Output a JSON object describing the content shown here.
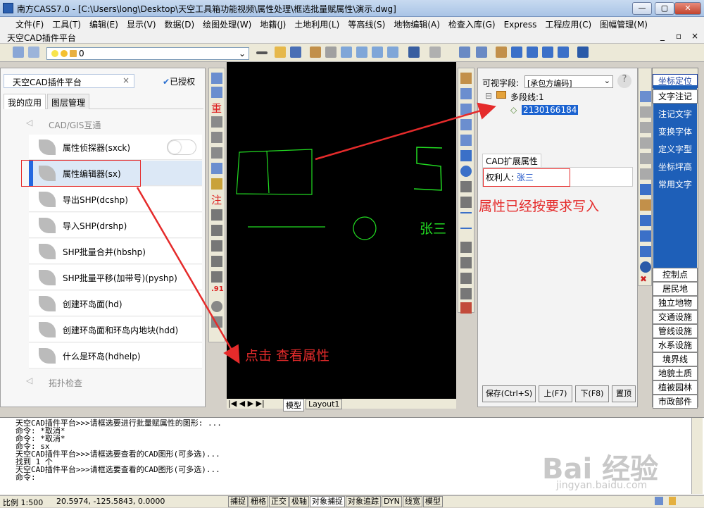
{
  "window": {
    "title": "南方CASS7.0 - [C:\\Users\\long\\Desktop\\天空工具箱功能视频\\属性处理\\框选批量赋属性\\演示.dwg]"
  },
  "menu": [
    "文件(F)",
    "工具(T)",
    "编辑(E)",
    "显示(V)",
    "数据(D)",
    "绘图处理(W)",
    "地籍(J)",
    "土地利用(L)",
    "等高线(S)",
    "地物编辑(A)",
    "检查入库(G)",
    "Express",
    "工程应用(C)",
    "图幅管理(M)"
  ],
  "subbar": {
    "label": "天空CAD插件平台"
  },
  "layer": {
    "value": "0"
  },
  "leftpanel": {
    "title": "天空CAD插件平台",
    "badge": "已授权",
    "tabs": [
      "我的应用",
      "图层管理"
    ],
    "section1": "CAD/GIS互通",
    "section2": "拓扑检查",
    "items": [
      "属性侦探器(sxck)",
      "属性编辑器(sx)",
      "导出SHP(dcshp)",
      "导入SHP(drshp)",
      "SHP批量合并(hbshp)",
      "SHP批量平移(加带号)(pyshp)",
      "创建环岛面(hd)",
      "创建环岛面和环岛内地块(hdd)",
      "什么是环岛(hdhelp)"
    ]
  },
  "left_strip_chars": [
    "重",
    "注",
    ".91"
  ],
  "cad": {
    "text": "张三",
    "tabs": [
      "模型",
      "Layout1"
    ]
  },
  "rightpanel": {
    "field_label": "可视字段:",
    "field_value": "[承包方编码]",
    "tree_root": "多段线:1",
    "tree_child": "2130166184",
    "attr_tab": "CAD扩展属性",
    "attr_key": "权利人:",
    "attr_value": "张三",
    "buttons": [
      "保存(Ctrl+S)",
      "上(F7)",
      "下(F8)",
      "置顶"
    ]
  },
  "farright": {
    "top": "坐标定位",
    "blue_items": [
      "文字注记",
      "注记文字",
      "变换字体",
      "定义字型",
      "坐标坪高",
      "常用文字"
    ],
    "list": [
      "控制点",
      "居民地",
      "独立地物",
      "交通设施",
      "管线设施",
      "水系设施",
      "境界线",
      "地貌土质",
      "植被园林",
      "市政部件"
    ]
  },
  "annotations": {
    "click": "点击 查看属性",
    "written": "属性已经按要求写入"
  },
  "command": {
    "lines": [
      "天空CAD插件平台>>>请框选要进行批量赋属性的图形: ...",
      "命令: *取消*",
      "命令: *取消*",
      "命令: sx",
      "天空CAD插件平台>>>请框选要查看的CAD图形(可多选)...",
      "找到 1 个",
      "天空CAD插件平台>>>请框选要查看的CAD图形(可多选)...",
      "命令:"
    ]
  },
  "status": {
    "scale": "比例 1:500",
    "coords": "20.5974, -125.5843, 0.0000",
    "buttons": [
      "捕捉",
      "栅格",
      "正交",
      "极轴",
      "对象捕捉",
      "对象追踪",
      "DYN",
      "线宽",
      "模型"
    ]
  },
  "watermark": {
    "text": "Bai 经验",
    "url": "jingyan.baidu.com"
  },
  "colors": {
    "accent": "#2468e0",
    "red": "#e52b2b",
    "cad_green": "#22dd22",
    "blue_panel": "#1e5fb8"
  }
}
